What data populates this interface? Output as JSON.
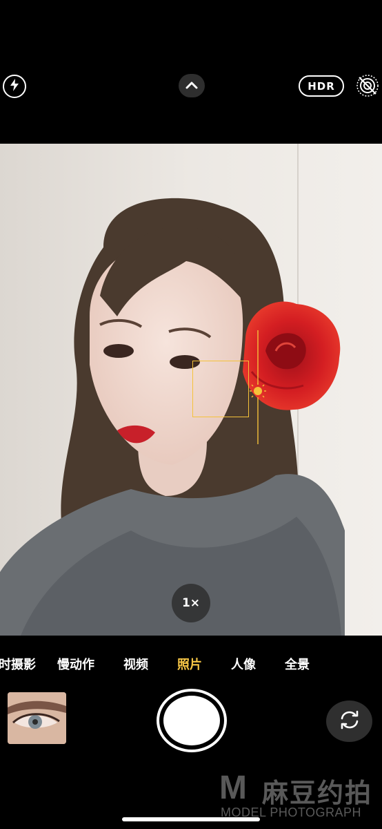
{
  "top_bar": {
    "flash_icon": "flash-bolt-icon",
    "expand_icon": "chevron-up-icon",
    "hdr_label": "HDR",
    "live_icon": "live-photo-off-icon"
  },
  "viewfinder": {
    "zoom_label": "1×",
    "focus_icon": "exposure-sun-icon"
  },
  "modes": {
    "items": [
      "时摄影",
      "慢动作",
      "视频",
      "照片",
      "人像",
      "全景"
    ],
    "active": "照片"
  },
  "bottom": {
    "thumbnail": "last-photo-thumbnail",
    "shutter_icon": "shutter-button",
    "switch_icon": "camera-flip-icon"
  },
  "watermark": {
    "mark": "M",
    "chinese": "麻豆约拍",
    "english": "MODEL PHOTOGRAPH"
  },
  "colors": {
    "accent": "#f7c646",
    "focus": "#f5c23a",
    "rose": "#d01f1f",
    "background": "#000000"
  }
}
